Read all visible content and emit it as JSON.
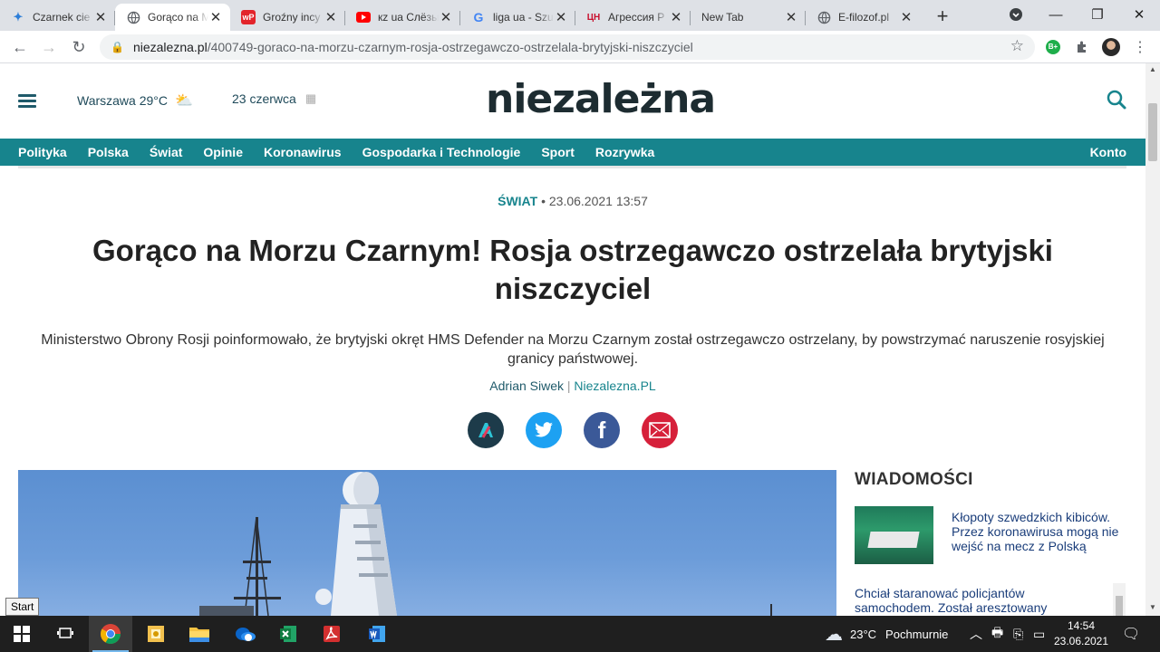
{
  "browser": {
    "tabs": [
      {
        "title": "Czarnek cie",
        "favicon": "blue-puzzle",
        "active": false
      },
      {
        "title": "Gorąco na M",
        "favicon": "globe",
        "active": true
      },
      {
        "title": "Groźny incy",
        "favicon": "wp",
        "active": false
      },
      {
        "title": "кz ua Слёзы",
        "favicon": "youtube",
        "active": false
      },
      {
        "title": "liga ua - Szu",
        "favicon": "google",
        "active": false
      },
      {
        "title": "Агрессия Р",
        "favicon": "cn-red",
        "active": false
      },
      {
        "title": "New Tab",
        "favicon": "none",
        "active": false
      },
      {
        "title": "E-filozof.pl",
        "favicon": "globe",
        "active": false
      }
    ],
    "url_host": "niezalezna.pl",
    "url_path": "/400749-goraco-na-morzu-czarnym-rosja-ostrzegawczo-ostrzelala-brytyjski-niszczyciel",
    "extension_badge": "B+"
  },
  "site": {
    "weather": "Warszawa 29°C",
    "date": "23 czerwca",
    "logo": "niezależna",
    "nav": [
      "Polityka",
      "Polska",
      "Świat",
      "Opinie",
      "Koronawirus",
      "Gospodarka i Technologie",
      "Sport",
      "Rozrywka"
    ],
    "account": "Konto"
  },
  "article": {
    "category": "ŚWIAT",
    "datetime": "23.06.2021 13:57",
    "title": "Gorąco na Morzu Czarnym! Rosja ostrzegawczo ostrzelała brytyjski niszczyciel",
    "lead": "Ministerstwo Obrony Rosji poinformowało, że brytyjski okręt HMS Defender na Morzu Czarnym został ostrzegawczo ostrzelany, by powstrzymać naruszenie rosyjskiej granicy państwowej.",
    "author": "Adrian Siwek",
    "source": "Niezalezna.PL",
    "byline_sep": "|",
    "share": [
      {
        "name": "autor",
        "color": "#1d3b4a",
        "glyph": "A"
      },
      {
        "name": "twitter",
        "color": "#1da1f2",
        "glyph": "🐦"
      },
      {
        "name": "facebook",
        "color": "#3b5998",
        "glyph": "f"
      },
      {
        "name": "email",
        "color": "#d6203a",
        "glyph": "✉"
      }
    ]
  },
  "sidebar": {
    "title": "WIADOMOŚCI",
    "items": [
      {
        "text": "Kłopoty szwedzkich kibiców. Przez koronawirusa mogą nie wejść na mecz z Polską"
      },
      {
        "text": "Chciał staranować policjantów samochodem. Został aresztowany"
      }
    ]
  },
  "tooltip": "Start",
  "taskbar": {
    "weather": "23°C",
    "weather_desc": "Pochmurnie",
    "time": "14:54",
    "date": "23.06.2021"
  },
  "colors": {
    "accent": "#17848d",
    "logo": "#1d2c31",
    "link": "#1a3d7a"
  }
}
